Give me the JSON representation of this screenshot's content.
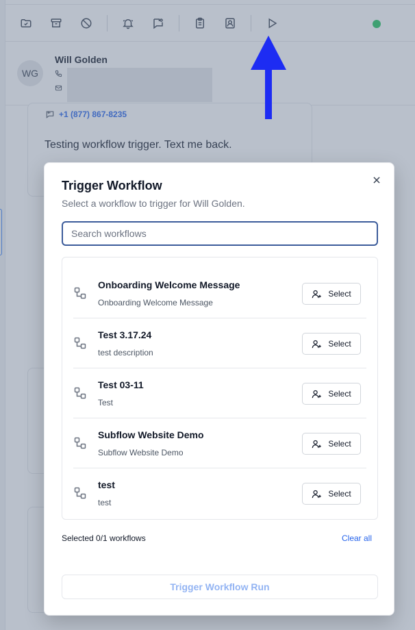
{
  "toolbar": {
    "icons": [
      "folder-check-icon",
      "archive-icon",
      "ban-icon",
      "bell-icon",
      "message-flag-icon",
      "clipboard-icon",
      "contact-card-icon",
      "play-icon"
    ],
    "status_color": "#22c55e"
  },
  "contact": {
    "initials": "WG",
    "name": "Will Golden"
  },
  "message": {
    "phone": "+1 (877) 867-8235",
    "text": "Testing workflow trigger. Text me back."
  },
  "modal": {
    "title": "Trigger Workflow",
    "subtitle": "Select a workflow to trigger for Will Golden.",
    "search_placeholder": "Search workflows",
    "workflows": [
      {
        "name": "Onboarding Welcome Message",
        "description": "Onboarding Welcome Message",
        "select_label": "Select"
      },
      {
        "name": "Test 3.17.24",
        "description": "test description",
        "select_label": "Select"
      },
      {
        "name": "Test 03-11",
        "description": "Test",
        "select_label": "Select"
      },
      {
        "name": "Subflow Website Demo",
        "description": "Subflow Website Demo",
        "select_label": "Select"
      },
      {
        "name": "test",
        "description": "test",
        "select_label": "Select"
      }
    ],
    "selected_count": "Selected 0/1 workflows",
    "clear_all": "Clear all",
    "run_button": "Trigger Workflow Run"
  },
  "colors": {
    "accent": "#2563eb",
    "annotation_arrow": "#1d2cf3",
    "disabled_text": "#93b4f3"
  }
}
